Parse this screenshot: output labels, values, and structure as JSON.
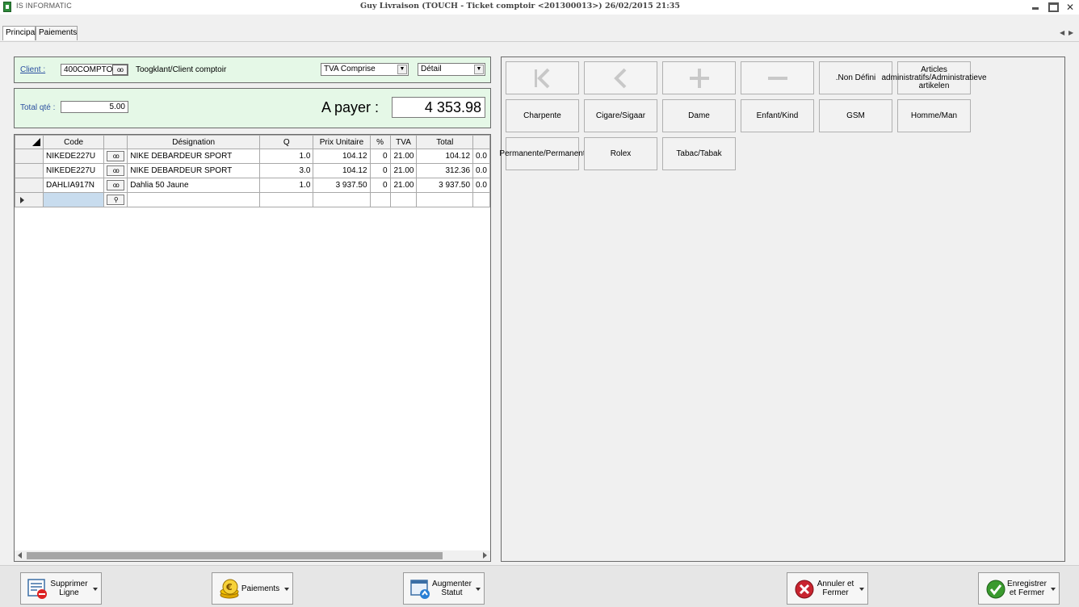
{
  "app": {
    "name": "IS INFORMATIC",
    "window_title": "Guy    Livraison  (TOUCH - Ticket comptoir <201300013>)    26/02/2015 21:35"
  },
  "tabs": [
    {
      "label": "Principal",
      "active": true
    },
    {
      "label": "Paiements",
      "active": false
    }
  ],
  "client": {
    "label": "Client",
    "colon": " :",
    "code": "400COMPTO",
    "name": "Toogklant/Client comptoir",
    "tva_mode": "TVA Comprise",
    "view_mode": "Détail"
  },
  "totals": {
    "total_qte_label": "Total qté :",
    "total_qte": "5.00",
    "a_payer_label": "A payer :",
    "a_payer": "4 353.98"
  },
  "grid": {
    "columns": [
      "Code",
      "",
      "Désignation",
      "Q",
      "Prix Unitaire",
      "%",
      "TVA",
      "Total",
      ""
    ],
    "rows": [
      {
        "code": "NIKEDE227U",
        "designation": "NIKE DEBARDEUR SPORT",
        "q": "1.0",
        "prix": "104.12",
        "pct": "0",
        "tva": "21.00",
        "total": "104.12",
        "extra": "0.0"
      },
      {
        "code": "NIKEDE227U",
        "designation": "NIKE DEBARDEUR SPORT",
        "q": "3.0",
        "prix": "104.12",
        "pct": "0",
        "tva": "21.00",
        "total": "312.36",
        "extra": "0.0"
      },
      {
        "code": "DAHLIA917N",
        "designation": "Dahlia 50 Jaune",
        "q": "1.0",
        "prix": "3 937.50",
        "pct": "0",
        "tva": "21.00",
        "total": "3 937.50",
        "extra": "0.0"
      }
    ]
  },
  "categories": {
    "tiles": [
      ".Non Défini",
      "Articles administratifs/Administratieve artikelen",
      "Charpente",
      "Cigare/Sigaar",
      "Dame",
      "Enfant/Kind",
      "GSM",
      "Homme/Man",
      "Permanente/Permanent",
      "Rolex",
      "Tabac/Tabak"
    ]
  },
  "toolbar": {
    "supprimer": "Supprimer Ligne",
    "paiements": "Paiements",
    "augmenter": "Augmenter Statut",
    "annuler": "Annuler et Fermer",
    "enregistrer": "Enregistrer et Fermer"
  },
  "colors": {
    "panel_green": "#e5f8e7",
    "label_blue": "#2a4fa0",
    "cancel_red": "#c8242f",
    "ok_green": "#3a9a2e"
  }
}
